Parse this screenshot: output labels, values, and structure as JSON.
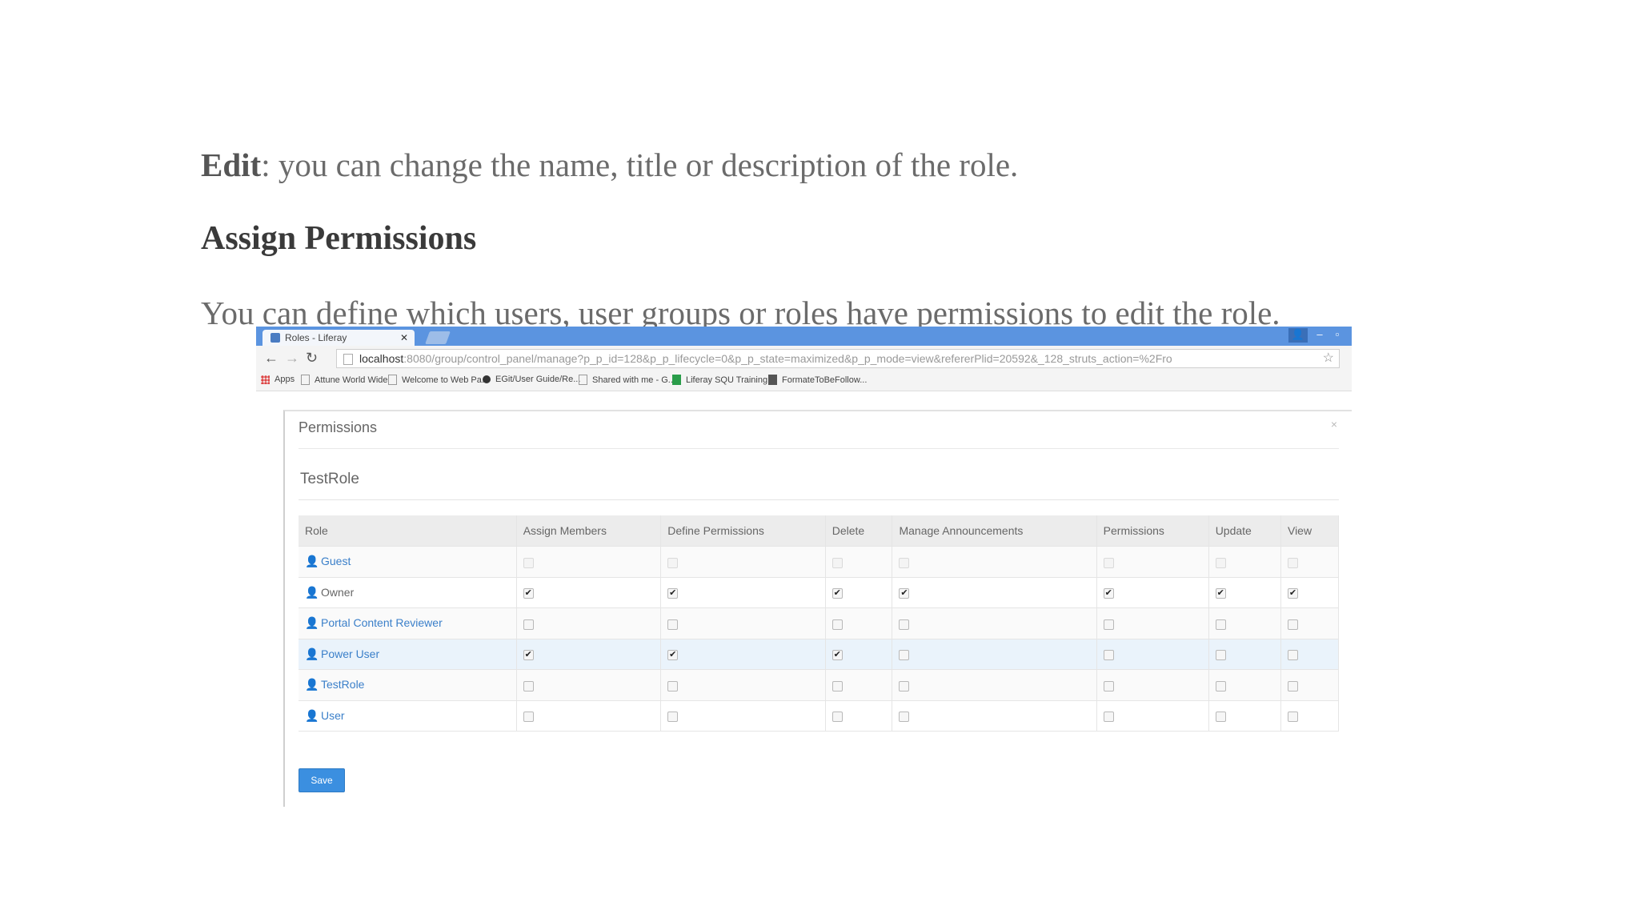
{
  "document": {
    "edit_term": "Edit",
    "edit_text": ": you can change the name, title or description of the role.",
    "heading": "Assign Permissions",
    "define_text": "You can define which users, user groups or roles have permissions to edit the role."
  },
  "browser": {
    "tab_title": "Roles - Liferay",
    "url_host": "localhost",
    "url_rest": ":8080/group/control_panel/manage?p_p_id=128&p_p_lifecycle=0&p_p_state=maximized&p_p_mode=view&refererPlid=20592&_128_struts_action=%2Fro",
    "bookmarks": [
      "Apps",
      "Attune World Wide",
      "Welcome to Web Pa...",
      "EGit/User Guide/Re...",
      "Shared with me - G...",
      "Liferay SQU Training...",
      "FormateToBeFollow..."
    ]
  },
  "modal": {
    "title": "Permissions",
    "subtitle": "TestRole",
    "columns": [
      "Role",
      "Assign Members",
      "Define Permissions",
      "Delete",
      "Manage Announcements",
      "Permissions",
      "Update",
      "View"
    ],
    "rows": [
      {
        "role": "Guest",
        "checks": [
          false,
          false,
          false,
          false,
          false,
          false,
          false
        ],
        "disabled": true
      },
      {
        "role": "Owner",
        "checks": [
          true,
          true,
          true,
          true,
          true,
          true,
          true
        ],
        "disabled": false
      },
      {
        "role": "Portal Content Reviewer",
        "checks": [
          false,
          false,
          false,
          false,
          false,
          false,
          false
        ],
        "disabled": false
      },
      {
        "role": "Power User",
        "checks": [
          true,
          true,
          true,
          false,
          false,
          false,
          false
        ],
        "disabled": false
      },
      {
        "role": "TestRole",
        "checks": [
          false,
          false,
          false,
          false,
          false,
          false,
          false
        ],
        "disabled": false
      },
      {
        "role": "User",
        "checks": [
          false,
          false,
          false,
          false,
          false,
          false,
          false
        ],
        "disabled": false
      }
    ],
    "save_label": "Save"
  },
  "icons": {
    "user_icon": "user-icon",
    "guest_icon": "guest-user-icon",
    "checkmark_glyph": "✔"
  }
}
